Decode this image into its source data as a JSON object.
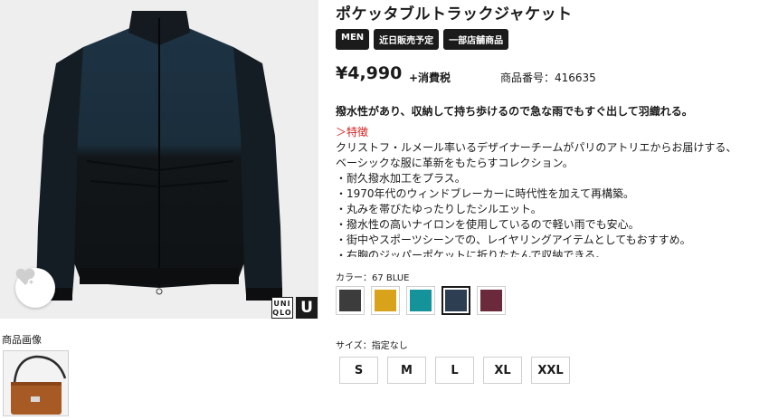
{
  "product": {
    "title": "ポケッタブルトラックジャケット",
    "tags": [
      "MEN",
      "近日販売予定",
      "一部店舗商品"
    ],
    "price": "¥4,990",
    "tax_note": "+消費税",
    "product_number": "商品番号：416635",
    "headline": "撥水性があり、収納して持ち歩けるので急な雨でもすぐ出して羽織れる。"
  },
  "features": {
    "heading": "＞特徴",
    "lines": [
      "クリストフ・ルメール率いるデザイナーチームがパリのアトリエからお届けする、",
      "ベーシックな服に革新をもたらすコレクション。",
      "・耐久撥水加工をプラス。",
      "・1970年代のウィンドブレーカーに時代性を加えて再構築。",
      "・丸みを帯びたゆったりしたシルエット。",
      "・撥水性の高いナイロンを使用しているので軽い雨でも安心。",
      "・街中やスポーツシーンでの、レイヤリングアイテムとしてもおすすめ。",
      "・右胸のジッパーポケットに折りたたんで収納できる。"
    ]
  },
  "color": {
    "label": "カラー：67 BLUE",
    "swatches": [
      {
        "name": "dark-gray",
        "hex": "#3c3c3c",
        "selected": false
      },
      {
        "name": "mustard",
        "hex": "#d9a21b",
        "selected": false
      },
      {
        "name": "teal",
        "hex": "#14939a",
        "selected": false
      },
      {
        "name": "navy-blue",
        "hex": "#2e3e52",
        "selected": true
      },
      {
        "name": "wine",
        "hex": "#6a2a3c",
        "selected": false
      }
    ]
  },
  "size": {
    "label": "サイズ：指定なし",
    "options": [
      "S",
      "M",
      "L",
      "XL",
      "XXL"
    ]
  },
  "images": {
    "thumbnail_label": "商品画像",
    "logo_text": "UNI QLO",
    "logo_u": "U"
  },
  "colors": {
    "jacket_top": "#1d3344",
    "jacket_bottom": "#111417",
    "image_bg": "#eeeeee",
    "bag": "#a85a24",
    "accent_red": "#d41e1e"
  }
}
